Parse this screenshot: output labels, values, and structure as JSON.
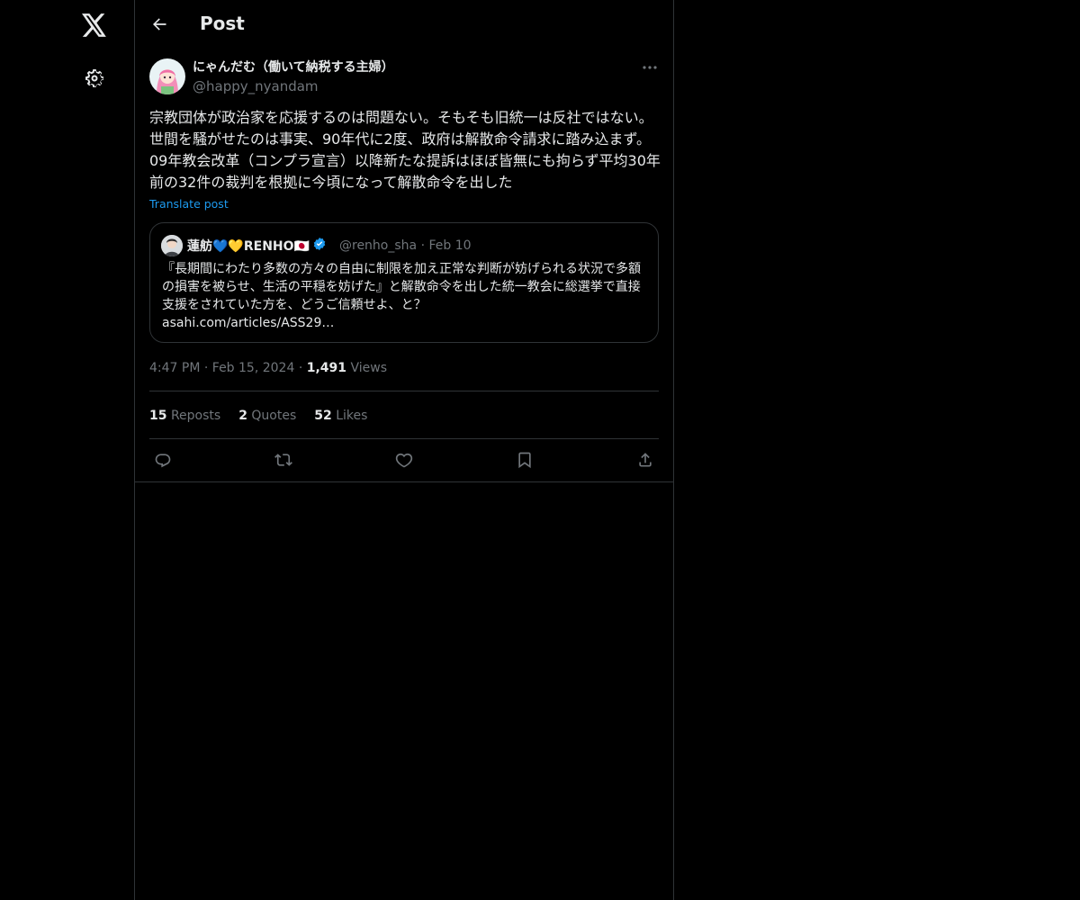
{
  "nav": {
    "logo_icon": "x-logo-icon",
    "settings_icon": "gear-icon"
  },
  "header": {
    "title": "Post"
  },
  "post": {
    "author_name": "にゃんだむ（働いて納税する主婦）",
    "author_handle": "@happy_nyandam",
    "text": "宗教団体が政治家を応援するのは問題ない。そもそも旧統一は反社ではない。世間を騒がせたのは事実、90年代に2度、政府は解散命令請求に踏み込まず。09年教会改革（コンプラ宣言）以降新たな提訴はほぼ皆無にも拘らず平均30年前の32件の裁判を根拠に今頃になって解散命令を出した",
    "translate_label": "Translate post",
    "time": "4:47 PM",
    "date": "Feb 15, 2024",
    "views_count": "1,491",
    "views_label": "Views",
    "reposts_count": "15",
    "reposts_label": "Reposts",
    "quotes_count": "2",
    "quotes_label": "Quotes",
    "likes_count": "52",
    "likes_label": "Likes"
  },
  "quote": {
    "author_name": "蓮舫💙💛RENHO🇯🇵",
    "author_handle": "@renho_sha",
    "date": "Feb 10",
    "text": "『長期間にわたり多数の方々の自由に制限を加え正常な判断が妨げられる状況で多額の損害を被らせ、生活の平穏を妨げた』と解散命令を出した統一教会に総選挙で直接支援をされていた方を、どうご信頼せよ、と？",
    "link": "asahi.com/articles/ASS29…"
  },
  "colors": {
    "background": "#000000",
    "text": "#e7e9ea",
    "muted": "#71767b",
    "border": "#2f3336",
    "accent": "#1d9bf0"
  }
}
